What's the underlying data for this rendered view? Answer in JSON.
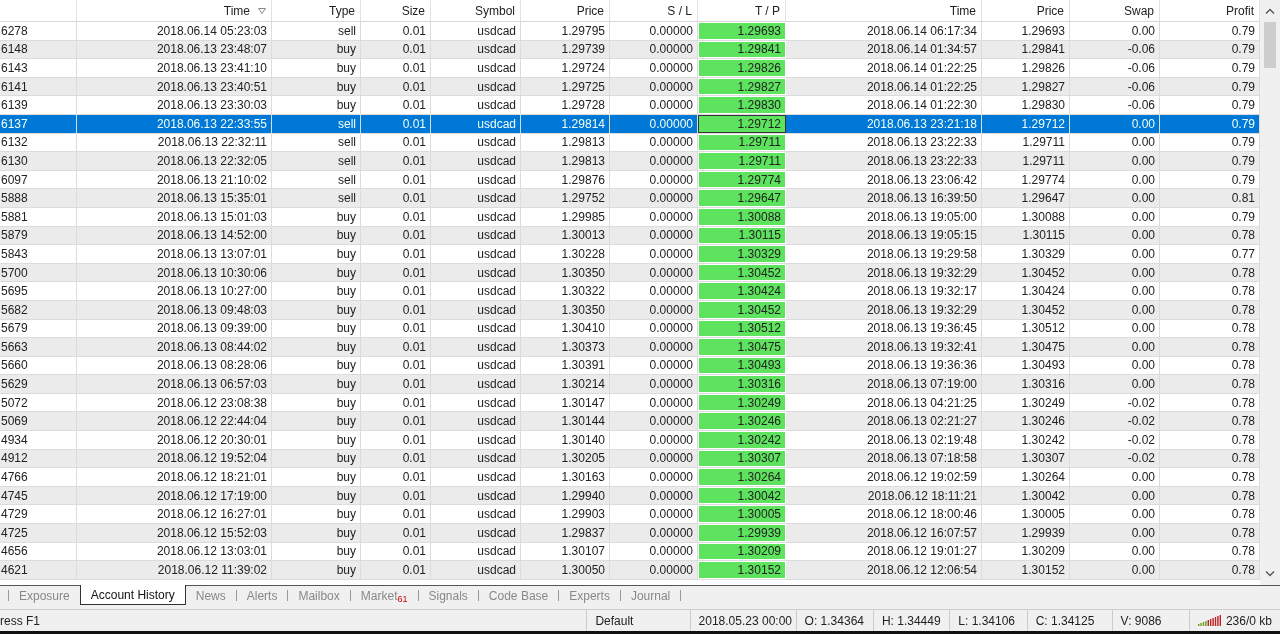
{
  "table": {
    "columns": [
      {
        "label": "Time",
        "sorted": true,
        "highlighted": false
      },
      {
        "label": "Type",
        "sorted": false,
        "highlighted": false
      },
      {
        "label": "Size",
        "sorted": false,
        "highlighted": false
      },
      {
        "label": "Symbol",
        "sorted": false,
        "highlighted": false
      },
      {
        "label": "Price",
        "sorted": false,
        "highlighted": false
      },
      {
        "label": "S / L",
        "sorted": false,
        "highlighted": false
      },
      {
        "label": "T / P",
        "sorted": false,
        "highlighted": true
      },
      {
        "label": "Time",
        "sorted": false,
        "highlighted": false
      },
      {
        "label": "Price",
        "sorted": false,
        "highlighted": false
      },
      {
        "label": "Swap",
        "sorted": false,
        "highlighted": false
      },
      {
        "label": "Profit",
        "sorted": false,
        "highlighted": false
      }
    ],
    "rows": [
      {
        "order": "6278",
        "open_time": "2018.06.14 05:23:03",
        "type": "sell",
        "size": "0.01",
        "symbol": "usdcad",
        "open_price": "1.29795",
        "sl": "0.00000",
        "tp": "1.29693",
        "close_time": "2018.06.14 06:17:34",
        "close_price": "1.29693",
        "swap": "0.00",
        "profit": "0.79",
        "selected": false
      },
      {
        "order": "6148",
        "open_time": "2018.06.13 23:48:07",
        "type": "buy",
        "size": "0.01",
        "symbol": "usdcad",
        "open_price": "1.29739",
        "sl": "0.00000",
        "tp": "1.29841",
        "close_time": "2018.06.14 01:34:57",
        "close_price": "1.29841",
        "swap": "-0.06",
        "profit": "0.79",
        "selected": false
      },
      {
        "order": "6143",
        "open_time": "2018.06.13 23:41:10",
        "type": "buy",
        "size": "0.01",
        "symbol": "usdcad",
        "open_price": "1.29724",
        "sl": "0.00000",
        "tp": "1.29826",
        "close_time": "2018.06.14 01:22:25",
        "close_price": "1.29826",
        "swap": "-0.06",
        "profit": "0.79",
        "selected": false
      },
      {
        "order": "6141",
        "open_time": "2018.06.13 23:40:51",
        "type": "buy",
        "size": "0.01",
        "symbol": "usdcad",
        "open_price": "1.29725",
        "sl": "0.00000",
        "tp": "1.29827",
        "close_time": "2018.06.14 01:22:25",
        "close_price": "1.29827",
        "swap": "-0.06",
        "profit": "0.79",
        "selected": false
      },
      {
        "order": "6139",
        "open_time": "2018.06.13 23:30:03",
        "type": "buy",
        "size": "0.01",
        "symbol": "usdcad",
        "open_price": "1.29728",
        "sl": "0.00000",
        "tp": "1.29830",
        "close_time": "2018.06.14 01:22:30",
        "close_price": "1.29830",
        "swap": "-0.06",
        "profit": "0.79",
        "selected": false
      },
      {
        "order": "6137",
        "open_time": "2018.06.13 22:33:55",
        "type": "sell",
        "size": "0.01",
        "symbol": "usdcad",
        "open_price": "1.29814",
        "sl": "0.00000",
        "tp": "1.29712",
        "close_time": "2018.06.13 23:21:18",
        "close_price": "1.29712",
        "swap": "0.00",
        "profit": "0.79",
        "selected": true
      },
      {
        "order": "6132",
        "open_time": "2018.06.13 22:32:11",
        "type": "sell",
        "size": "0.01",
        "symbol": "usdcad",
        "open_price": "1.29813",
        "sl": "0.00000",
        "tp": "1.29711",
        "close_time": "2018.06.13 23:22:33",
        "close_price": "1.29711",
        "swap": "0.00",
        "profit": "0.79",
        "selected": false
      },
      {
        "order": "6130",
        "open_time": "2018.06.13 22:32:05",
        "type": "sell",
        "size": "0.01",
        "symbol": "usdcad",
        "open_price": "1.29813",
        "sl": "0.00000",
        "tp": "1.29711",
        "close_time": "2018.06.13 23:22:33",
        "close_price": "1.29711",
        "swap": "0.00",
        "profit": "0.79",
        "selected": false
      },
      {
        "order": "6097",
        "open_time": "2018.06.13 21:10:02",
        "type": "sell",
        "size": "0.01",
        "symbol": "usdcad",
        "open_price": "1.29876",
        "sl": "0.00000",
        "tp": "1.29774",
        "close_time": "2018.06.13 23:06:42",
        "close_price": "1.29774",
        "swap": "0.00",
        "profit": "0.79",
        "selected": false
      },
      {
        "order": "5888",
        "open_time": "2018.06.13 15:35:01",
        "type": "sell",
        "size": "0.01",
        "symbol": "usdcad",
        "open_price": "1.29752",
        "sl": "0.00000",
        "tp": "1.29647",
        "close_time": "2018.06.13 16:39:50",
        "close_price": "1.29647",
        "swap": "0.00",
        "profit": "0.81",
        "selected": false
      },
      {
        "order": "5881",
        "open_time": "2018.06.13 15:01:03",
        "type": "buy",
        "size": "0.01",
        "symbol": "usdcad",
        "open_price": "1.29985",
        "sl": "0.00000",
        "tp": "1.30088",
        "close_time": "2018.06.13 19:05:00",
        "close_price": "1.30088",
        "swap": "0.00",
        "profit": "0.79",
        "selected": false
      },
      {
        "order": "5879",
        "open_time": "2018.06.13 14:52:00",
        "type": "buy",
        "size": "0.01",
        "symbol": "usdcad",
        "open_price": "1.30013",
        "sl": "0.00000",
        "tp": "1.30115",
        "close_time": "2018.06.13 19:05:15",
        "close_price": "1.30115",
        "swap": "0.00",
        "profit": "0.78",
        "selected": false
      },
      {
        "order": "5843",
        "open_time": "2018.06.13 13:07:01",
        "type": "buy",
        "size": "0.01",
        "symbol": "usdcad",
        "open_price": "1.30228",
        "sl": "0.00000",
        "tp": "1.30329",
        "close_time": "2018.06.13 19:29:58",
        "close_price": "1.30329",
        "swap": "0.00",
        "profit": "0.77",
        "selected": false
      },
      {
        "order": "5700",
        "open_time": "2018.06.13 10:30:06",
        "type": "buy",
        "size": "0.01",
        "symbol": "usdcad",
        "open_price": "1.30350",
        "sl": "0.00000",
        "tp": "1.30452",
        "close_time": "2018.06.13 19:32:29",
        "close_price": "1.30452",
        "swap": "0.00",
        "profit": "0.78",
        "selected": false
      },
      {
        "order": "5695",
        "open_time": "2018.06.13 10:27:00",
        "type": "buy",
        "size": "0.01",
        "symbol": "usdcad",
        "open_price": "1.30322",
        "sl": "0.00000",
        "tp": "1.30424",
        "close_time": "2018.06.13 19:32:17",
        "close_price": "1.30424",
        "swap": "0.00",
        "profit": "0.78",
        "selected": false
      },
      {
        "order": "5682",
        "open_time": "2018.06.13 09:48:03",
        "type": "buy",
        "size": "0.01",
        "symbol": "usdcad",
        "open_price": "1.30350",
        "sl": "0.00000",
        "tp": "1.30452",
        "close_time": "2018.06.13 19:32:29",
        "close_price": "1.30452",
        "swap": "0.00",
        "profit": "0.78",
        "selected": false
      },
      {
        "order": "5679",
        "open_time": "2018.06.13 09:39:00",
        "type": "buy",
        "size": "0.01",
        "symbol": "usdcad",
        "open_price": "1.30410",
        "sl": "0.00000",
        "tp": "1.30512",
        "close_time": "2018.06.13 19:36:45",
        "close_price": "1.30512",
        "swap": "0.00",
        "profit": "0.78",
        "selected": false
      },
      {
        "order": "5663",
        "open_time": "2018.06.13 08:44:02",
        "type": "buy",
        "size": "0.01",
        "symbol": "usdcad",
        "open_price": "1.30373",
        "sl": "0.00000",
        "tp": "1.30475",
        "close_time": "2018.06.13 19:32:41",
        "close_price": "1.30475",
        "swap": "0.00",
        "profit": "0.78",
        "selected": false
      },
      {
        "order": "5660",
        "open_time": "2018.06.13 08:28:06",
        "type": "buy",
        "size": "0.01",
        "symbol": "usdcad",
        "open_price": "1.30391",
        "sl": "0.00000",
        "tp": "1.30493",
        "close_time": "2018.06.13 19:36:36",
        "close_price": "1.30493",
        "swap": "0.00",
        "profit": "0.78",
        "selected": false
      },
      {
        "order": "5629",
        "open_time": "2018.06.13 06:57:03",
        "type": "buy",
        "size": "0.01",
        "symbol": "usdcad",
        "open_price": "1.30214",
        "sl": "0.00000",
        "tp": "1.30316",
        "close_time": "2018.06.13 07:19:00",
        "close_price": "1.30316",
        "swap": "0.00",
        "profit": "0.78",
        "selected": false
      },
      {
        "order": "5072",
        "open_time": "2018.06.12 23:08:38",
        "type": "buy",
        "size": "0.01",
        "symbol": "usdcad",
        "open_price": "1.30147",
        "sl": "0.00000",
        "tp": "1.30249",
        "close_time": "2018.06.13 04:21:25",
        "close_price": "1.30249",
        "swap": "-0.02",
        "profit": "0.78",
        "selected": false
      },
      {
        "order": "5069",
        "open_time": "2018.06.12 22:44:04",
        "type": "buy",
        "size": "0.01",
        "symbol": "usdcad",
        "open_price": "1.30144",
        "sl": "0.00000",
        "tp": "1.30246",
        "close_time": "2018.06.13 02:21:27",
        "close_price": "1.30246",
        "swap": "-0.02",
        "profit": "0.78",
        "selected": false
      },
      {
        "order": "4934",
        "open_time": "2018.06.12 20:30:01",
        "type": "buy",
        "size": "0.01",
        "symbol": "usdcad",
        "open_price": "1.30140",
        "sl": "0.00000",
        "tp": "1.30242",
        "close_time": "2018.06.13 02:19:48",
        "close_price": "1.30242",
        "swap": "-0.02",
        "profit": "0.78",
        "selected": false
      },
      {
        "order": "4912",
        "open_time": "2018.06.12 19:52:04",
        "type": "buy",
        "size": "0.01",
        "symbol": "usdcad",
        "open_price": "1.30205",
        "sl": "0.00000",
        "tp": "1.30307",
        "close_time": "2018.06.13 07:18:58",
        "close_price": "1.30307",
        "swap": "-0.02",
        "profit": "0.78",
        "selected": false
      },
      {
        "order": "4766",
        "open_time": "2018.06.12 18:21:01",
        "type": "buy",
        "size": "0.01",
        "symbol": "usdcad",
        "open_price": "1.30163",
        "sl": "0.00000",
        "tp": "1.30264",
        "close_time": "2018.06.12 19:02:59",
        "close_price": "1.30264",
        "swap": "0.00",
        "profit": "0.78",
        "selected": false
      },
      {
        "order": "4745",
        "open_time": "2018.06.12 17:19:00",
        "type": "buy",
        "size": "0.01",
        "symbol": "usdcad",
        "open_price": "1.29940",
        "sl": "0.00000",
        "tp": "1.30042",
        "close_time": "2018.06.12 18:11:21",
        "close_price": "1.30042",
        "swap": "0.00",
        "profit": "0.78",
        "selected": false
      },
      {
        "order": "4729",
        "open_time": "2018.06.12 16:27:01",
        "type": "buy",
        "size": "0.01",
        "symbol": "usdcad",
        "open_price": "1.29903",
        "sl": "0.00000",
        "tp": "1.30005",
        "close_time": "2018.06.12 18:00:46",
        "close_price": "1.30005",
        "swap": "0.00",
        "profit": "0.78",
        "selected": false
      },
      {
        "order": "4725",
        "open_time": "2018.06.12 15:52:03",
        "type": "buy",
        "size": "0.01",
        "symbol": "usdcad",
        "open_price": "1.29837",
        "sl": "0.00000",
        "tp": "1.29939",
        "close_time": "2018.06.12 16:07:57",
        "close_price": "1.29939",
        "swap": "0.00",
        "profit": "0.78",
        "selected": false
      },
      {
        "order": "4656",
        "open_time": "2018.06.12 13:03:01",
        "type": "buy",
        "size": "0.01",
        "symbol": "usdcad",
        "open_price": "1.30107",
        "sl": "0.00000",
        "tp": "1.30209",
        "close_time": "2018.06.12 19:01:27",
        "close_price": "1.30209",
        "swap": "0.00",
        "profit": "0.78",
        "selected": false
      },
      {
        "order": "4621",
        "open_time": "2018.06.12 11:39:02",
        "type": "buy",
        "size": "0.01",
        "symbol": "usdcad",
        "open_price": "1.30050",
        "sl": "0.00000",
        "tp": "1.30152",
        "close_time": "2018.06.12 12:06:54",
        "close_price": "1.30152",
        "swap": "0.00",
        "profit": "0.78",
        "selected": false
      }
    ]
  },
  "tabs": [
    {
      "label": "Exposure",
      "selected": false
    },
    {
      "label": "Account History",
      "selected": true
    },
    {
      "label": "News",
      "selected": false
    },
    {
      "label": "Alerts",
      "selected": false
    },
    {
      "label": "Mailbox",
      "selected": false
    },
    {
      "label": "Market",
      "badge": "61",
      "selected": false
    },
    {
      "label": "Signals",
      "selected": false
    },
    {
      "label": "Code Base",
      "selected": false
    },
    {
      "label": "Experts",
      "selected": false
    },
    {
      "label": "Journal",
      "selected": false
    }
  ],
  "status_bar": {
    "help": "ress F1",
    "items": [
      "Default",
      "2018.05.23 00:00",
      "O: 1.34364",
      "H: 1.34449",
      "L: 1.34106",
      "C: 1.34125",
      "V: 9086"
    ],
    "memory": "236/0 kb"
  }
}
